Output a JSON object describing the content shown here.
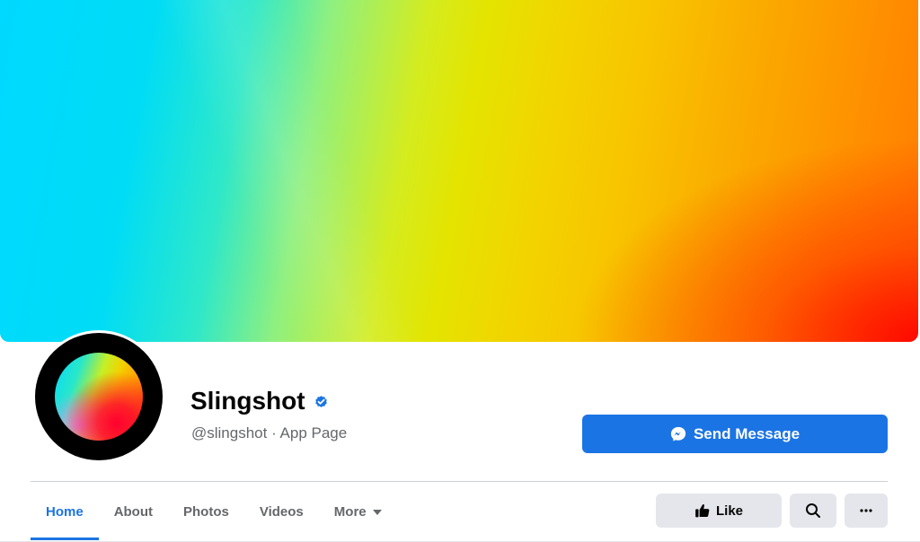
{
  "page": {
    "name": "Slingshot",
    "handle": "@slingshot",
    "category": "App Page",
    "subtitle": "@slingshot · App Page",
    "verified": true
  },
  "actions": {
    "send_message_label": "Send Message",
    "like_label": "Like"
  },
  "tabs": [
    {
      "label": "Home",
      "active": true
    },
    {
      "label": "About",
      "active": false
    },
    {
      "label": "Photos",
      "active": false
    },
    {
      "label": "Videos",
      "active": false
    },
    {
      "label": "More",
      "active": false
    }
  ],
  "icons": {
    "verified": "verified-badge-icon",
    "messenger": "messenger-icon",
    "like": "thumbs-up-icon",
    "search": "search-icon",
    "more": "ellipsis-icon",
    "caret": "caret-down-icon"
  },
  "colors": {
    "accent": "#1b74e4",
    "button_gray": "#e4e6eb",
    "secondary_text": "#65676b"
  }
}
